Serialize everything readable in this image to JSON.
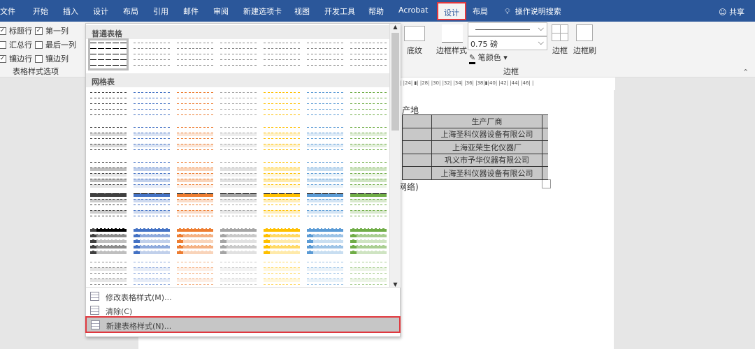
{
  "tabs": [
    "文件",
    "开始",
    "插入",
    "设计",
    "布局",
    "引用",
    "邮件",
    "审阅",
    "新建选项卡",
    "视图",
    "开发工具",
    "帮助",
    "Acrobat",
    "设计",
    "布局"
  ],
  "selected_tab_index": 13,
  "tell_me": "操作说明搜索",
  "share": "共享",
  "style_options": {
    "items": [
      {
        "label": "标题行",
        "checked": true
      },
      {
        "label": "第一列",
        "checked": true
      },
      {
        "label": "汇总行",
        "checked": false
      },
      {
        "label": "最后一列",
        "checked": false
      },
      {
        "label": "镶边行",
        "checked": true
      },
      {
        "label": "镶边列",
        "checked": false
      }
    ],
    "group_label": "表格样式选项"
  },
  "borders": {
    "shading": "底纹",
    "border_style": "边框样式",
    "weight": "0.75 磅",
    "pen_color": "笔颜色",
    "borders": "边框",
    "painter": "边框刷",
    "group_label": "边框"
  },
  "ruler": "|  |24|  ▮|  |28|  |30|  |32|  |34|  |36|  |38|▮|40|  |42|  |44|  |46|  |",
  "gallery": {
    "plain_header": "普通表格",
    "grid_header": "网格表",
    "palette": [
      "#404040",
      "#4472c4",
      "#ed7d31",
      "#a5a5a5",
      "#ffc000",
      "#5b9bd5",
      "#70ad47"
    ]
  },
  "menu": [
    "修改表格样式(M)...",
    "清除(C)",
    "新建表格样式(N)..."
  ],
  "document": {
    "heading_fragment": "产地",
    "table": [
      "生产厂商",
      "上海圣科仪器设备有限公司",
      "上海亚荣生化仪器厂",
      "巩义市予华仪器有限公司",
      "上海圣科仪器设备有限公司"
    ],
    "footer_fragment": "网络)"
  }
}
